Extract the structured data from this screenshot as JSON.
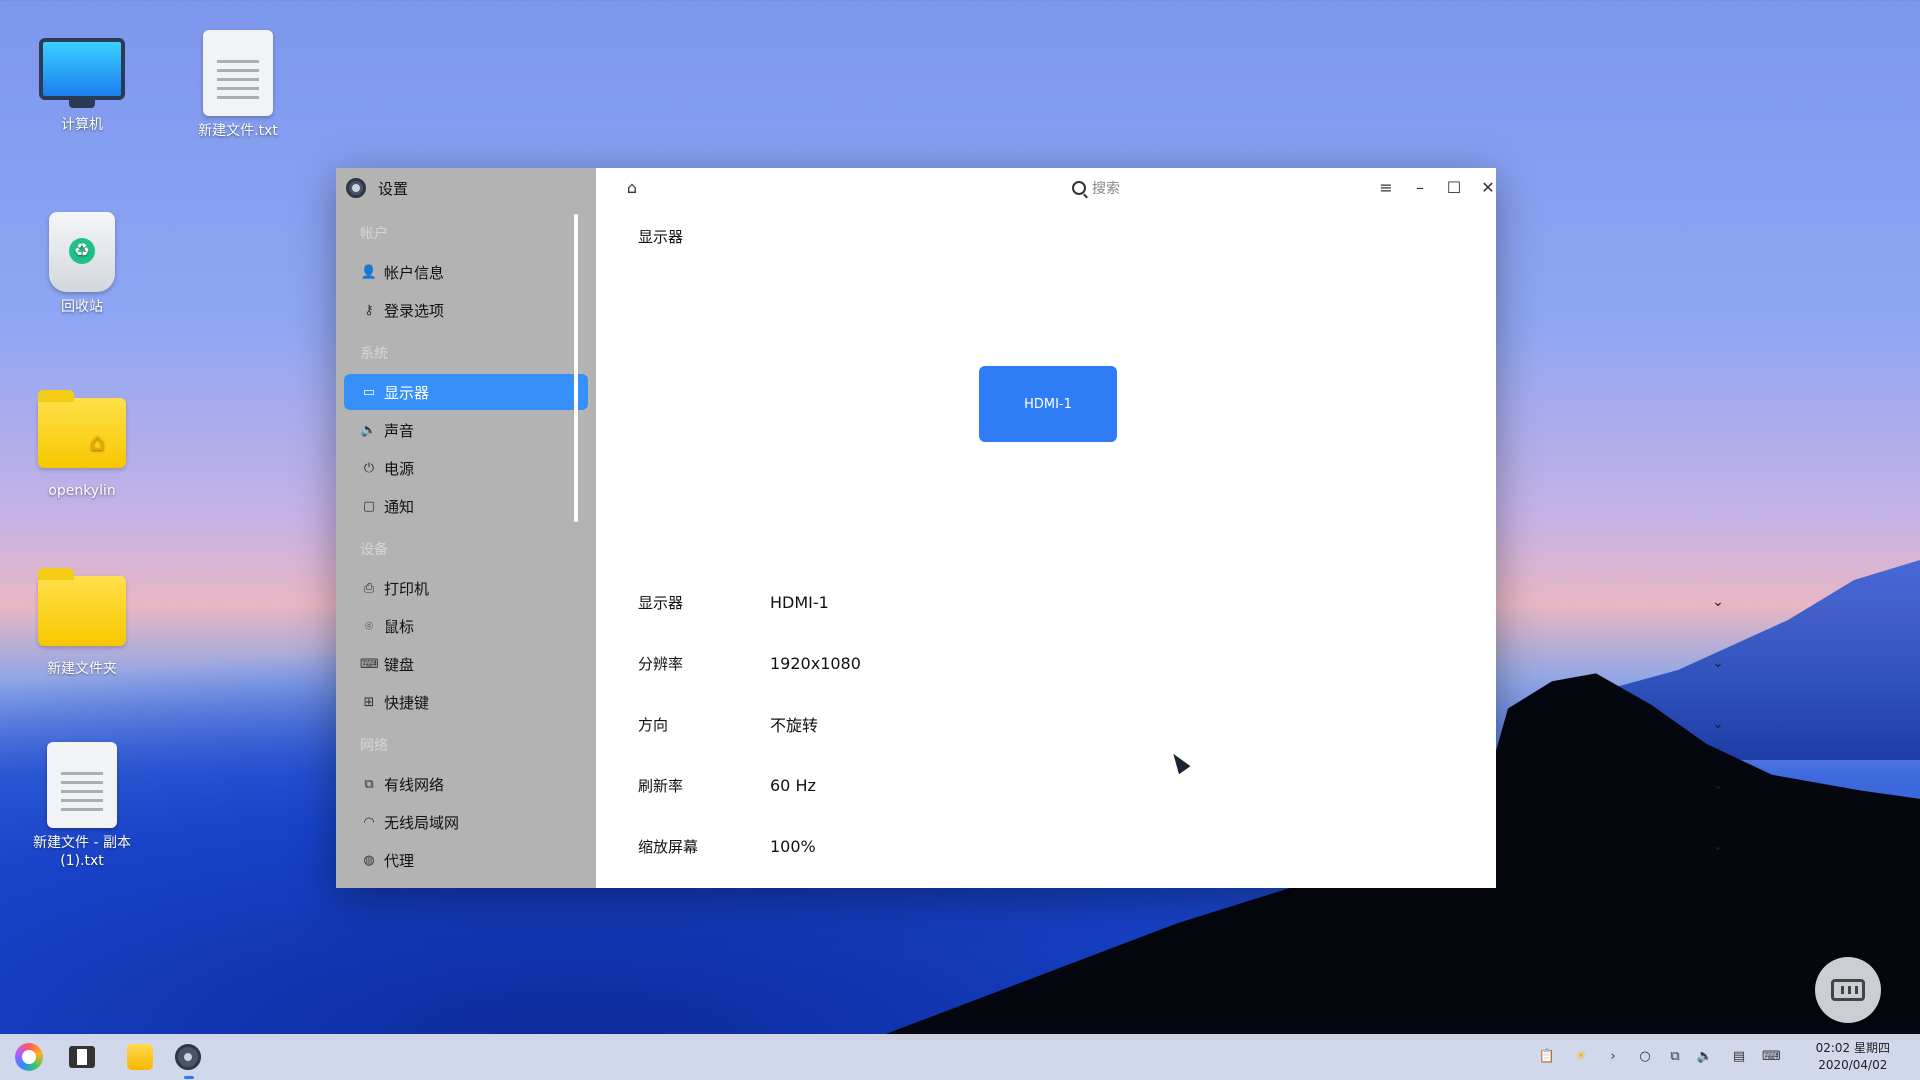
{
  "desktop": {
    "icons": [
      {
        "label": "计算机"
      },
      {
        "label": "新建文件.txt"
      },
      {
        "label": "回收站"
      },
      {
        "label": "openkylin"
      },
      {
        "label": "新建文件夹"
      },
      {
        "label": "新建文件 - 副本(1).txt"
      }
    ]
  },
  "window": {
    "title": "设置",
    "search_placeholder": "搜索",
    "sidebar": {
      "groups": [
        {
          "name": "帐户",
          "items": [
            {
              "label": "帐户信息",
              "icon": "user-icon"
            },
            {
              "label": "登录选项",
              "icon": "key-icon"
            }
          ]
        },
        {
          "name": "系统",
          "items": [
            {
              "label": "显示器",
              "icon": "display-icon"
            },
            {
              "label": "声音",
              "icon": "speaker-icon"
            },
            {
              "label": "电源",
              "icon": "power-icon"
            },
            {
              "label": "通知",
              "icon": "notification-icon"
            }
          ]
        },
        {
          "name": "设备",
          "items": [
            {
              "label": "打印机",
              "icon": "printer-icon"
            },
            {
              "label": "鼠标",
              "icon": "mouse-icon"
            },
            {
              "label": "键盘",
              "icon": "keyboard-icon"
            },
            {
              "label": "快捷键",
              "icon": "shortcut-icon"
            }
          ]
        },
        {
          "name": "网络",
          "items": [
            {
              "label": "有线网络",
              "icon": "wired-network-icon"
            },
            {
              "label": "无线局域网",
              "icon": "wifi-icon"
            },
            {
              "label": "代理",
              "icon": "proxy-icon"
            }
          ]
        }
      ],
      "active": "显示器"
    },
    "main": {
      "section_title": "显示器",
      "monitor_label": "HDMI-1",
      "rows": [
        {
          "label": "显示器",
          "value": "HDMI-1"
        },
        {
          "label": "分辨率",
          "value": "1920x1080"
        },
        {
          "label": "方向",
          "value": "不旋转"
        },
        {
          "label": "刷新率",
          "value": "60 Hz"
        },
        {
          "label": "缩放屏幕",
          "value": "100%"
        }
      ]
    }
  },
  "taskbar": {
    "clock_time": "02:02 星期四",
    "clock_date": "2020/04/02",
    "accent": "#2e7df6"
  }
}
